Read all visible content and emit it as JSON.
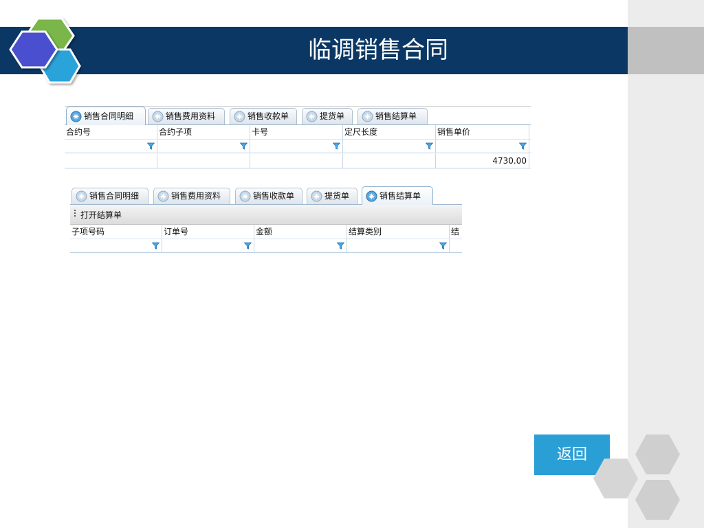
{
  "slide": {
    "title": "临调销售合同"
  },
  "grid1": {
    "tabs": [
      {
        "label": "销售合同明细",
        "active": true
      },
      {
        "label": "销售费用资料",
        "active": false
      },
      {
        "label": "销售收款单",
        "active": false
      },
      {
        "label": "提货单",
        "active": false
      },
      {
        "label": "销售结算单",
        "active": false
      }
    ],
    "columns": [
      "合约号",
      "合约子项",
      "卡号",
      "定尺长度",
      "销售单价"
    ],
    "rows": [
      [
        "",
        "",
        "",
        "",
        "4730.00"
      ]
    ]
  },
  "grid2": {
    "tabs": [
      {
        "label": "销售合同明细",
        "active": false
      },
      {
        "label": "销售费用资料",
        "active": false
      },
      {
        "label": "销售收款单",
        "active": false
      },
      {
        "label": "提货单",
        "active": false
      },
      {
        "label": "销售结算单",
        "active": true
      }
    ],
    "toolbar_label": "打开结算单",
    "columns": [
      "子项号码",
      "订单号",
      "金额",
      "结算类别",
      "结"
    ]
  },
  "nav": {
    "return_label": "返回"
  },
  "colors": {
    "title_bar": "#0b3764",
    "return_button": "#2a9fd6",
    "hex_blue": "#4a4fcf",
    "hex_green": "#7ab648",
    "hex_cyan": "#2ba3db",
    "deco_hex": "#cfcfcf"
  },
  "icons": {
    "tab": "tab-circle-icon",
    "filter": "filter-funnel-icon",
    "logo": "hexagon-cluster-icon"
  }
}
